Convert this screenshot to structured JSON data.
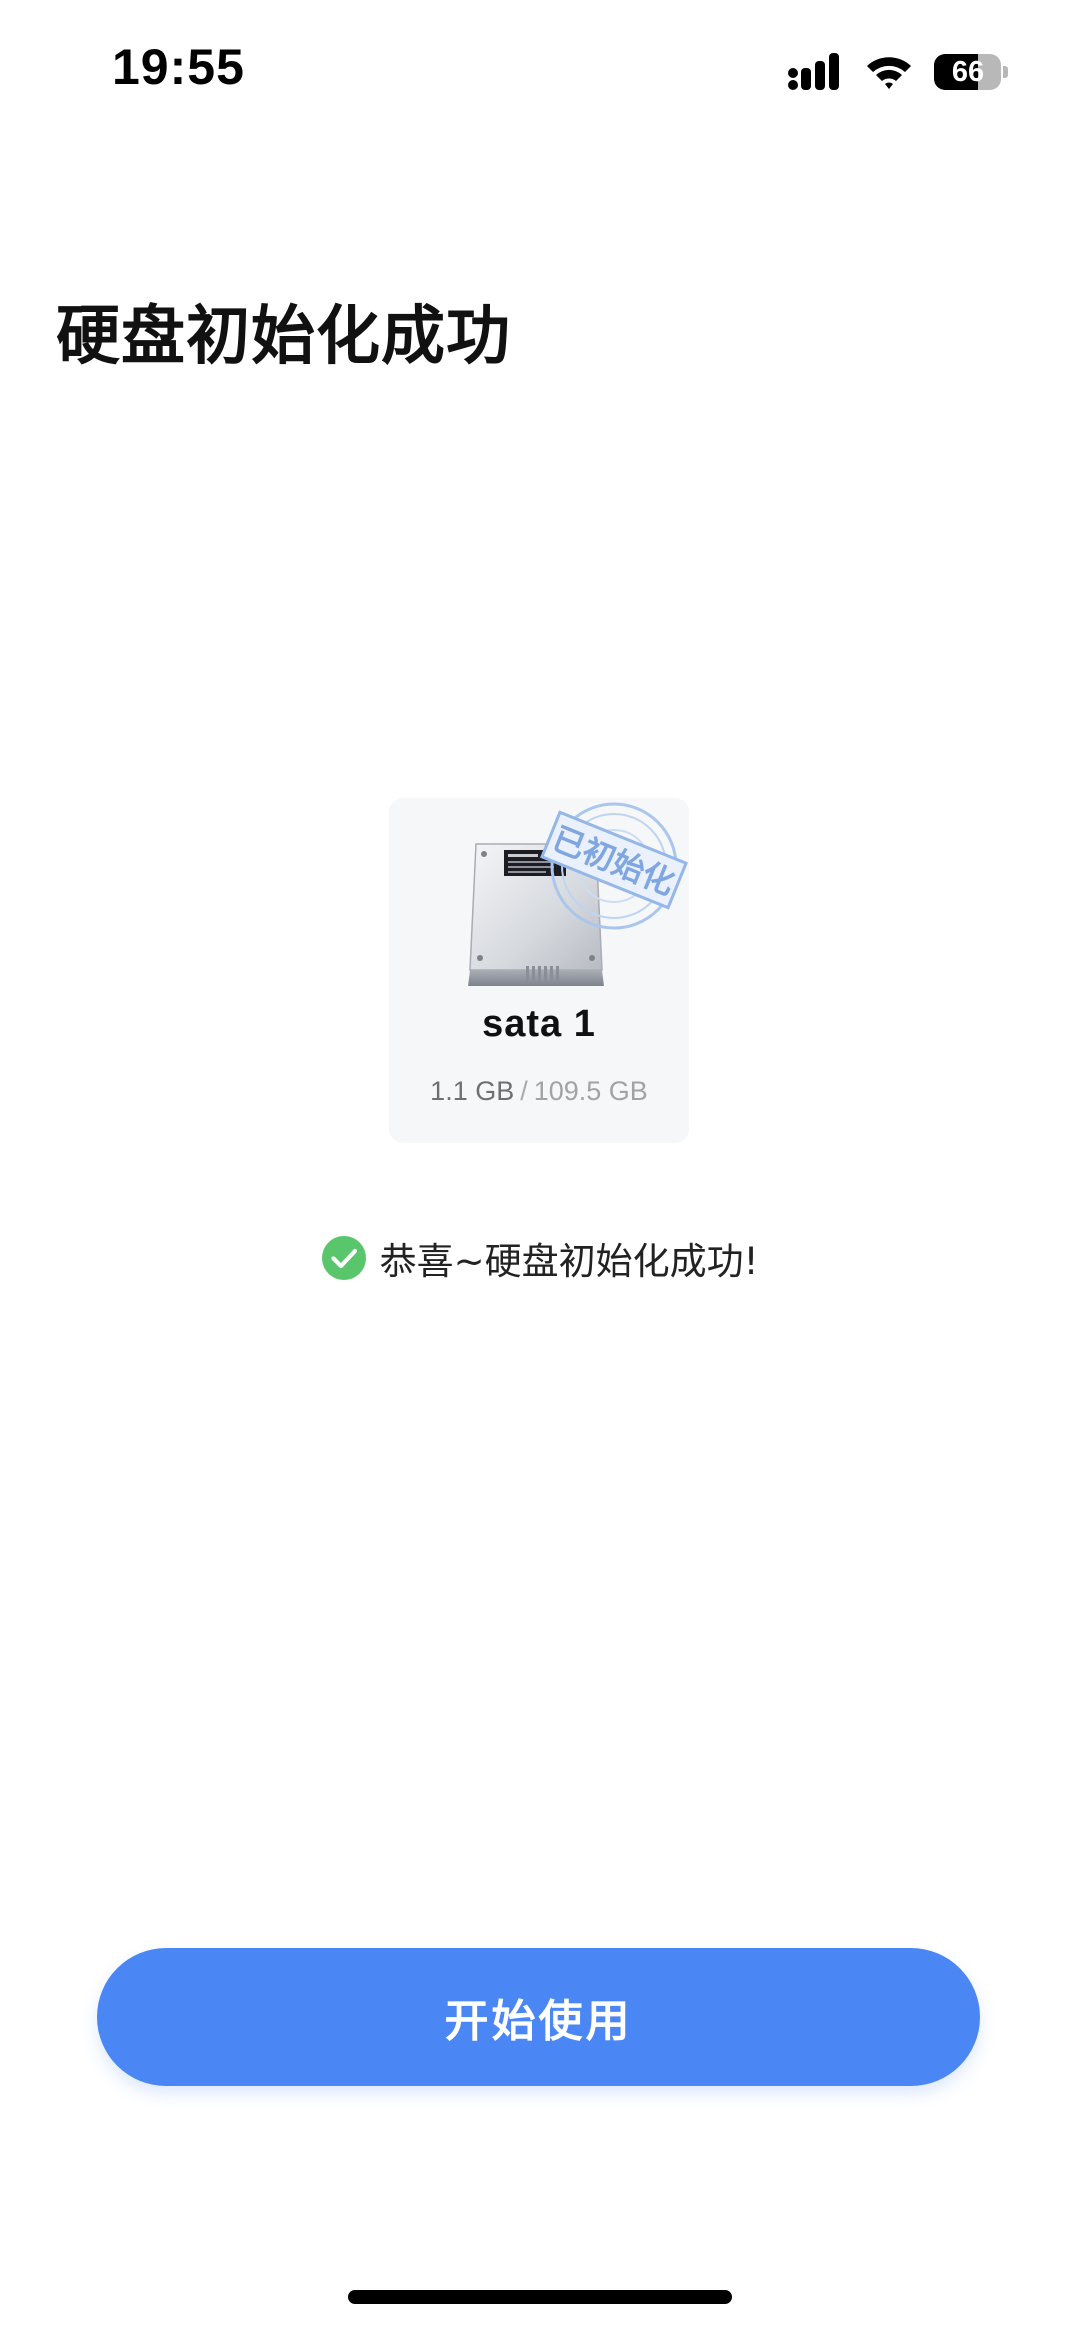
{
  "status_bar": {
    "time": "19:55",
    "battery_level": "66",
    "battery_fraction": 0.66
  },
  "page": {
    "title": "硬盘初始化成功"
  },
  "disk": {
    "name": "sata 1",
    "used": "1.1 GB",
    "separator": "/",
    "total": "109.5 GB",
    "stamp_label": "已初始化",
    "icon": "hard-drive-icon"
  },
  "message": {
    "text": "恭喜~硬盘初始化成功!",
    "icon": "check-circle-icon",
    "icon_color": "#5ac66b"
  },
  "actions": {
    "start_label": "开始使用",
    "button_color": "#4a86f4"
  }
}
